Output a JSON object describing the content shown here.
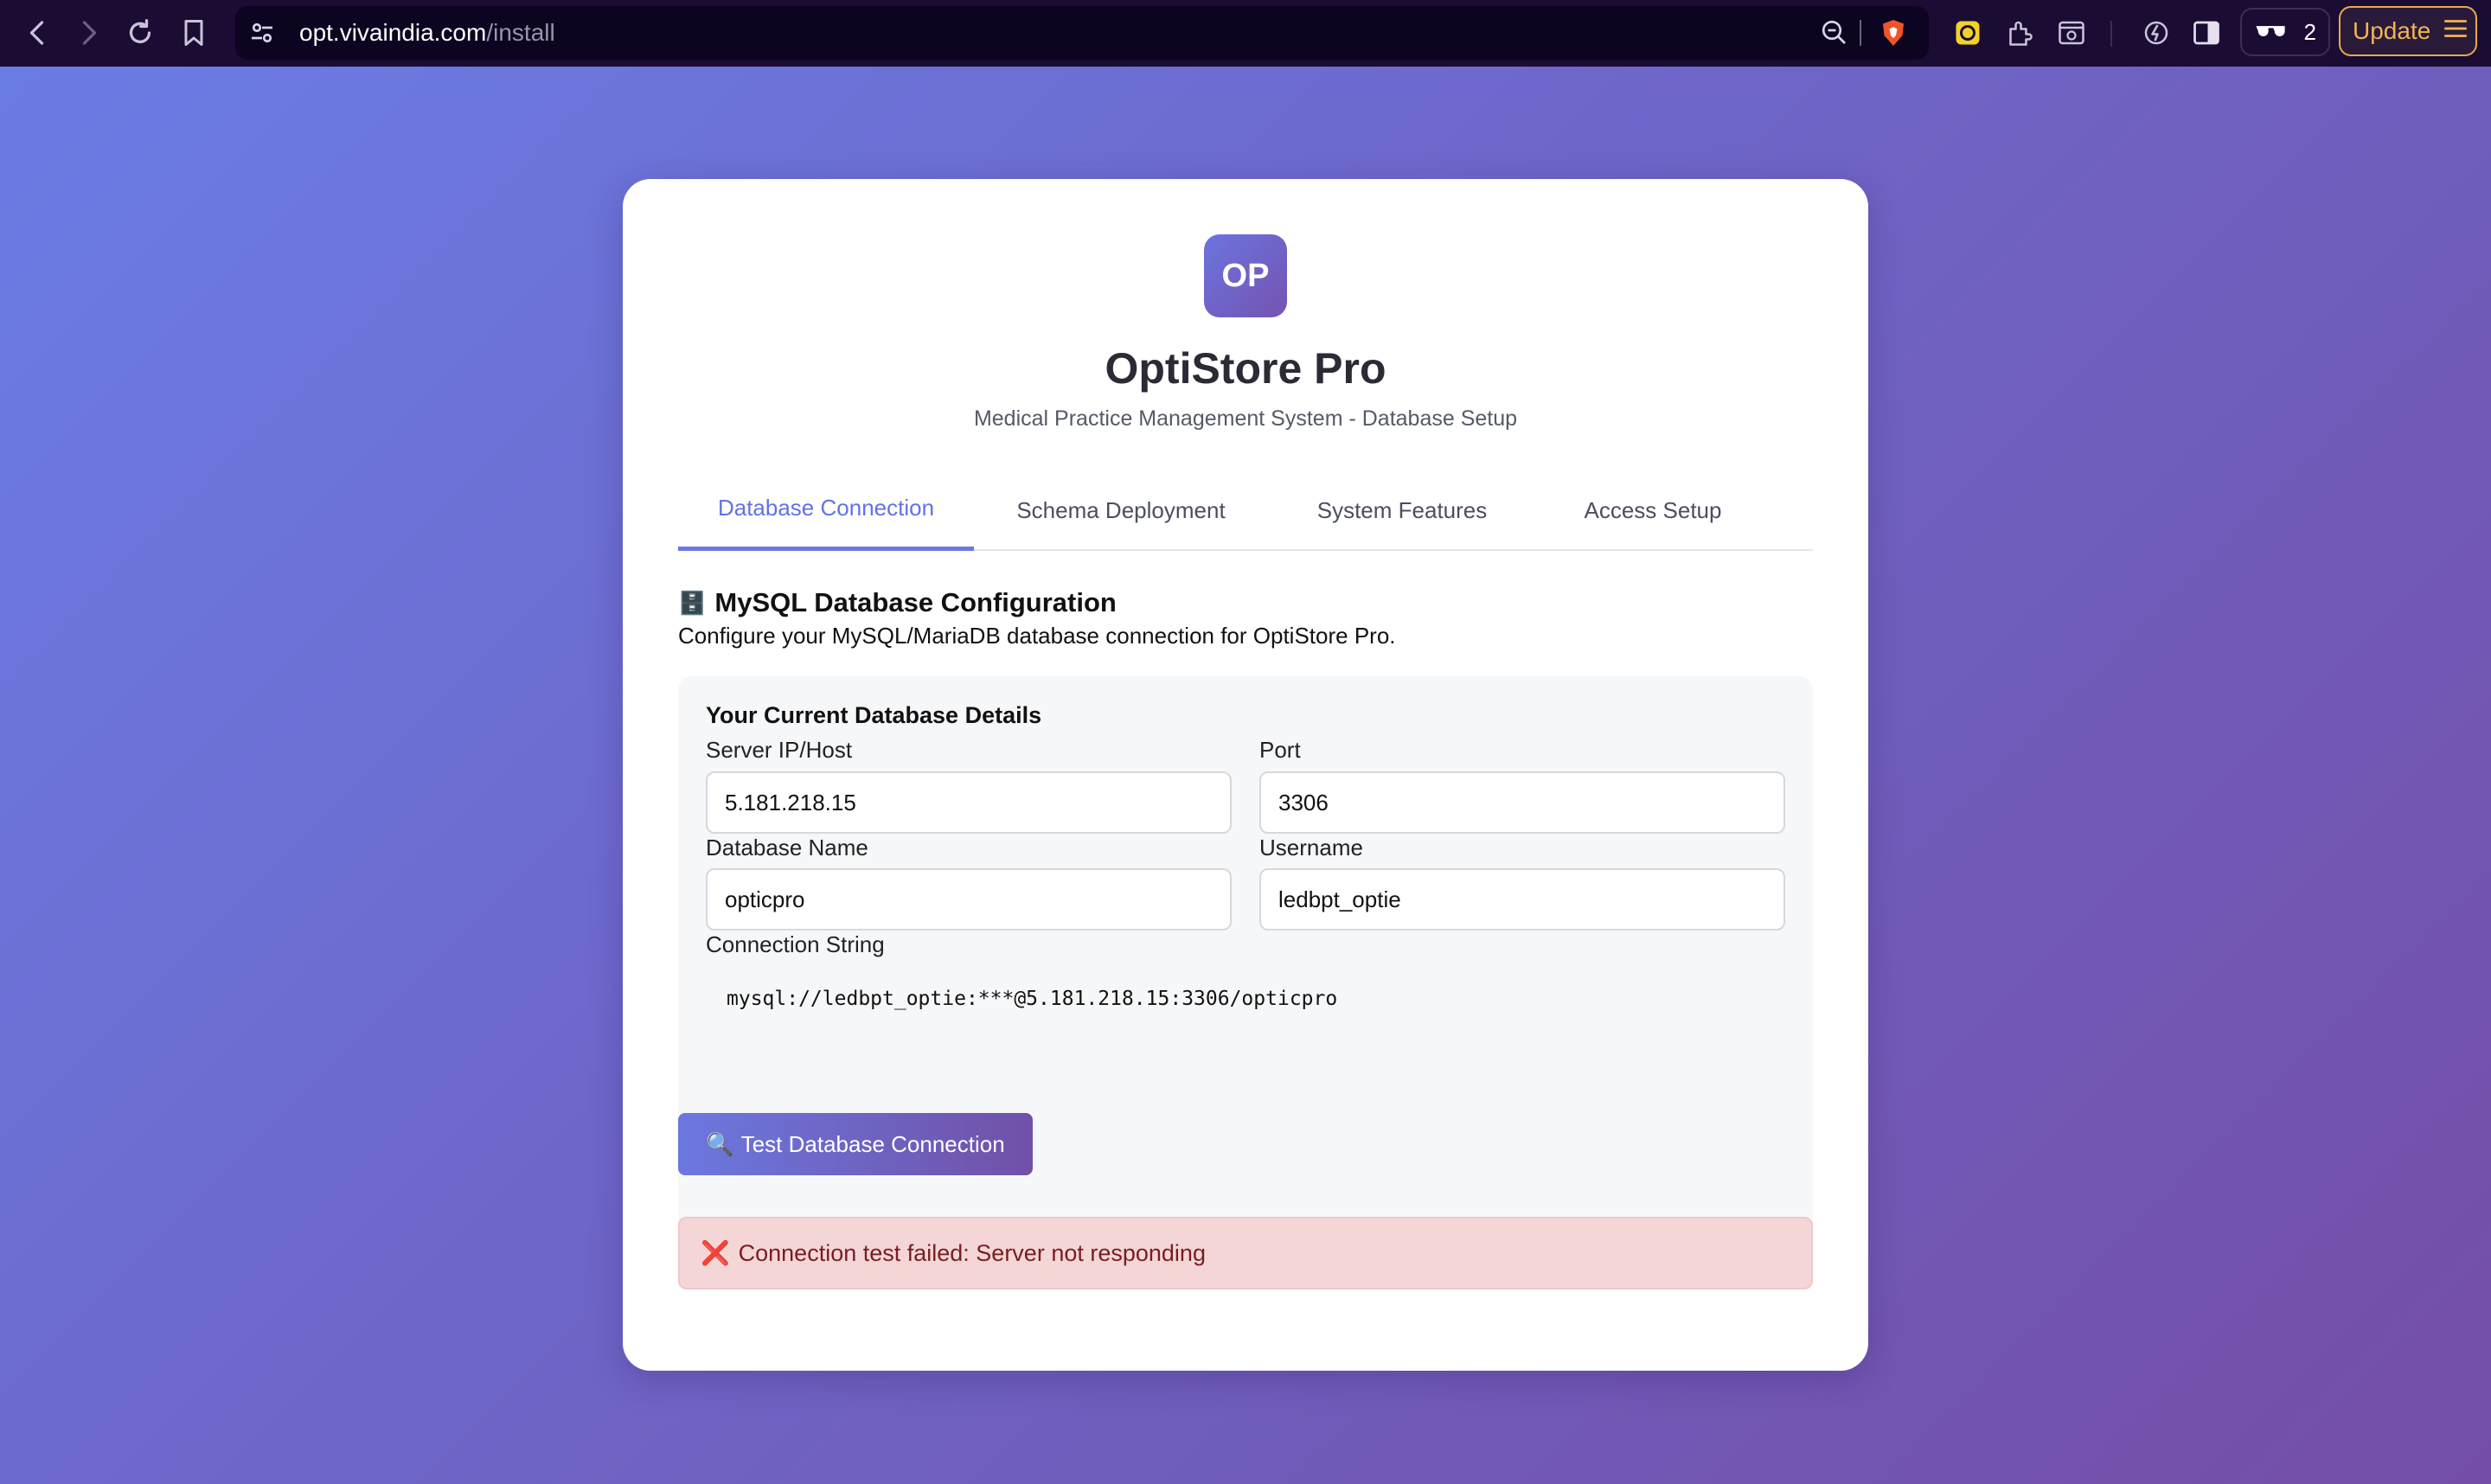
{
  "browser": {
    "url_host": "opt.vivaindia.com",
    "url_path": "/install",
    "extension_count": "2",
    "update_label": "Update"
  },
  "app": {
    "logo_text": "OP",
    "title": "OptiStore Pro",
    "subtitle": "Medical Practice Management System - Database Setup"
  },
  "tabs": [
    {
      "label": "Database Connection",
      "active": true
    },
    {
      "label": "Schema Deployment",
      "active": false
    },
    {
      "label": "System Features",
      "active": false
    },
    {
      "label": "Access Setup",
      "active": false
    }
  ],
  "section": {
    "icon": "🗄️",
    "title": "MySQL Database Configuration",
    "description": "Configure your MySQL/MariaDB database connection for OptiStore Pro."
  },
  "details": {
    "heading": "Your Current Database Details",
    "host_label": "Server IP/Host",
    "host_value": "5.181.218.15",
    "port_label": "Port",
    "port_value": "3306",
    "dbname_label": "Database Name",
    "dbname_value": "opticpro",
    "username_label": "Username",
    "username_value": "ledbpt_optie",
    "connstr_label": "Connection String",
    "connstr_value": "mysql://ledbpt_optie:***@5.181.218.15:3306/opticpro"
  },
  "actions": {
    "test_icon": "🔍",
    "test_label": "Test Database Connection"
  },
  "status": {
    "error_icon": "❌",
    "error_text": "Connection test failed: Server not responding"
  },
  "colors": {
    "accent": "#6272e4",
    "error_bg": "#f4d6d7",
    "error_text": "#7a1c21"
  }
}
